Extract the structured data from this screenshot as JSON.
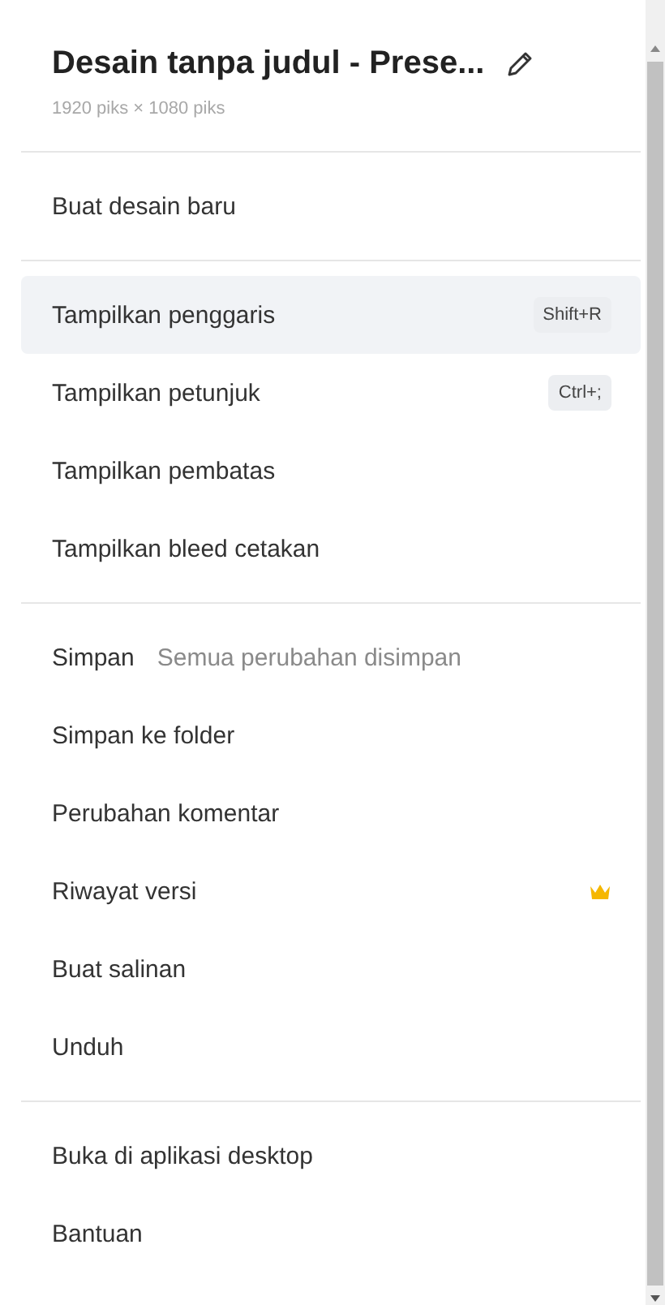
{
  "header": {
    "title": "Desain tanpa judul - Prese...",
    "subtitle": "1920 piks × 1080 piks"
  },
  "sections": [
    {
      "items": [
        {
          "label": "Buat desain baru",
          "highlighted": false
        }
      ]
    },
    {
      "items": [
        {
          "label": "Tampilkan penggaris",
          "highlighted": true,
          "shortcut": "Shift+R"
        },
        {
          "label": "Tampilkan petunjuk",
          "highlighted": false,
          "shortcut": "Ctrl+;"
        },
        {
          "label": "Tampilkan pembatas",
          "highlighted": false
        },
        {
          "label": "Tampilkan bleed cetakan",
          "highlighted": false
        }
      ]
    },
    {
      "items": [
        {
          "label": "Simpan",
          "highlighted": false,
          "status": "Semua perubahan disimpan"
        },
        {
          "label": "Simpan ke folder",
          "highlighted": false
        },
        {
          "label": "Perubahan komentar",
          "highlighted": false
        },
        {
          "label": "Riwayat versi",
          "highlighted": false,
          "premium": true
        },
        {
          "label": "Buat salinan",
          "highlighted": false
        },
        {
          "label": "Unduh",
          "highlighted": false
        }
      ]
    },
    {
      "items": [
        {
          "label": "Buka di aplikasi desktop",
          "highlighted": false
        },
        {
          "label": "Bantuan",
          "highlighted": false
        }
      ]
    }
  ]
}
